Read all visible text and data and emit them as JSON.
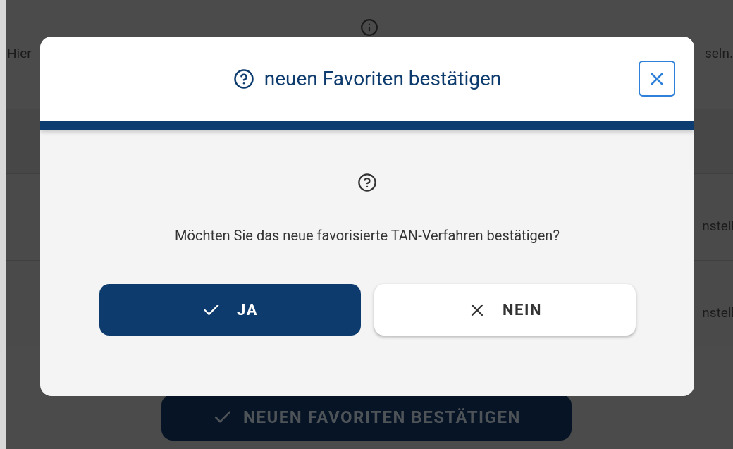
{
  "background": {
    "text_left": "Hier",
    "text_right": "seln.",
    "rows": [
      {
        "text_right": "nstell"
      },
      {
        "text_right": "nstell"
      }
    ],
    "confirm_button": {
      "label": "NEUEN FAVORITEN BESTÄTIGEN"
    }
  },
  "dialog": {
    "title": "neuen Favoriten bestätigen",
    "message": "Möchten Sie das neue favorisierte TAN-Verfahren bestätigen?",
    "buttons": [
      {
        "label": "JA",
        "kind": "confirm"
      },
      {
        "label": "NEIN",
        "kind": "cancel"
      }
    ]
  }
}
